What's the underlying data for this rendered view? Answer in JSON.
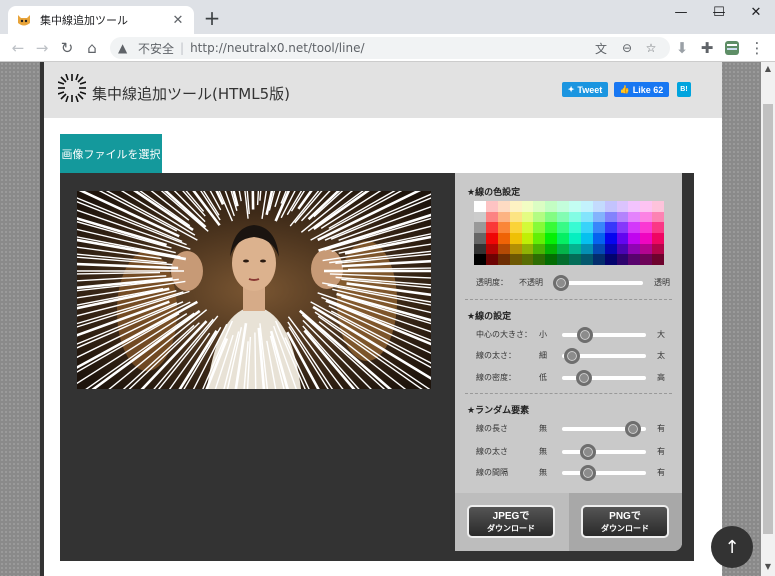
{
  "browser": {
    "tab_title": "集中線追加ツール",
    "tab_close": "✕",
    "new_tab": "+",
    "window_controls": {
      "minimize": "—",
      "maximize": "☐",
      "close": "✕"
    },
    "nav": {
      "back": "←",
      "forward": "→",
      "reload": "↻",
      "home": "⌂"
    },
    "omnibox": {
      "warning_icon": "▲",
      "insecure_label": "不安全",
      "separator": "|",
      "url": "http://neutralx0.net/tool/line/"
    },
    "toolbar_icons": {
      "translate": "文",
      "zoom": "⊖",
      "bookmark": "☆",
      "download": "⬇",
      "extensions": "✚",
      "menu": "⋮"
    }
  },
  "site": {
    "title": "集中線追加ツール(HTML5版)",
    "share": {
      "tweet": "Tweet",
      "like": "Like 62",
      "hatena": "B!"
    },
    "file_button": "画像ファイルを選択"
  },
  "panel": {
    "color_section": {
      "heading": "★線の色設定",
      "opacity_label": "透明度：",
      "opacity_min": "不透明",
      "opacity_max": "透明",
      "opacity_value": 0.02
    },
    "line_section": {
      "heading": "★線の設定",
      "rows": [
        {
          "label": "中心の大きさ：",
          "min": "小",
          "max": "大",
          "value": 0.27
        },
        {
          "label": "線の太さ：",
          "min": "細",
          "max": "太",
          "value": 0.12
        },
        {
          "label": "線の密度：",
          "min": "低",
          "max": "高",
          "value": 0.26
        }
      ]
    },
    "random_section": {
      "heading": "★ランダム要素",
      "rows": [
        {
          "label": "線の長さ",
          "min": "無",
          "max": "有",
          "value": 0.85
        },
        {
          "label": "線の太さ",
          "min": "無",
          "max": "有",
          "value": 0.31
        },
        {
          "label": "線の間隔",
          "min": "無",
          "max": "有",
          "value": 0.31
        }
      ]
    },
    "downloads": {
      "jpeg": {
        "line1": "JPEGで",
        "line2": "ダウンロード"
      },
      "png": {
        "line1": "PNGで",
        "line2": "ダウンロード"
      }
    }
  },
  "back_to_top": "↑",
  "colors": {
    "accent_teal": "#14999c",
    "workarea": "#333333",
    "panel": "#c9c9c9"
  }
}
